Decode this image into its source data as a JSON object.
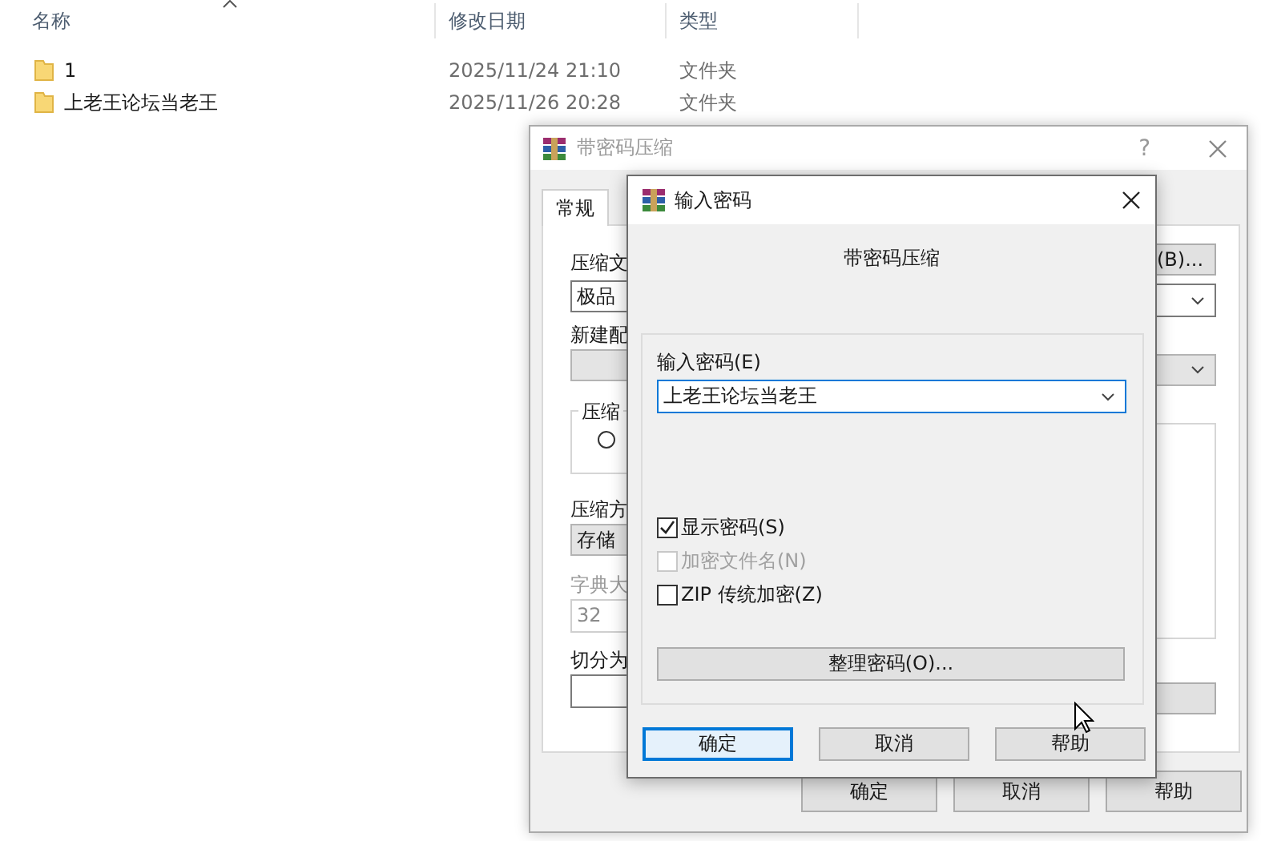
{
  "explorer": {
    "columns": [
      "名称",
      "修改日期",
      "类型"
    ],
    "rows": [
      {
        "name": "1",
        "modified": "2025/11/24 21:10",
        "type": "文件夹"
      },
      {
        "name": "上老王论坛当老王",
        "modified": "2025/11/26 20:28",
        "type": "文件夹"
      }
    ]
  },
  "back_window": {
    "title": "带密码压缩",
    "help": "?",
    "tabs": [
      {
        "label": "常规",
        "selected": true
      }
    ],
    "left": [
      {
        "kind": "label",
        "text": "压缩文",
        "disabled": false
      },
      {
        "kind": "combo",
        "value": "极品"
      },
      {
        "kind": "label",
        "text": "新建配",
        "disabled": false
      },
      {
        "kind": "dropdown"
      },
      {
        "kind": "group",
        "text": "压缩",
        "selected": false
      },
      {
        "kind": "label",
        "text": "压缩方",
        "disabled": false
      },
      {
        "kind": "dropdown",
        "value": "存储"
      },
      {
        "kind": "label",
        "text": "字典大",
        "disabled": true
      },
      {
        "kind": "field",
        "value": "32",
        "disabled": true
      },
      {
        "kind": "label",
        "text": "切分为",
        "disabled": false
      },
      {
        "kind": "field",
        "disabled": false
      }
    ],
    "right": [
      {
        "kind": "button",
        "text": "(B)..."
      },
      {
        "kind": "combo"
      },
      {
        "kind": "dropdown"
      },
      {
        "kind": "group"
      },
      {
        "kind": "button"
      }
    ],
    "buttons": [
      "确定",
      "取消",
      "帮助"
    ]
  },
  "dialog": {
    "title": "输入密码",
    "heading": "带密码压缩",
    "password_label": "输入密码(E)",
    "password": "上老王论坛当老王",
    "options": [
      {
        "label": "显示密码(S)",
        "checked": true,
        "disabled": false
      },
      {
        "label": "加密文件名(N)",
        "checked": false,
        "disabled": true
      },
      {
        "label": "ZIP 传统加密(Z)",
        "checked": false,
        "disabled": false
      }
    ],
    "organize_button": "整理密码(O)...",
    "buttons": [
      {
        "label": "确定",
        "default": true
      },
      {
        "label": "取消",
        "default": false
      },
      {
        "label": "帮助",
        "default": false
      }
    ]
  }
}
